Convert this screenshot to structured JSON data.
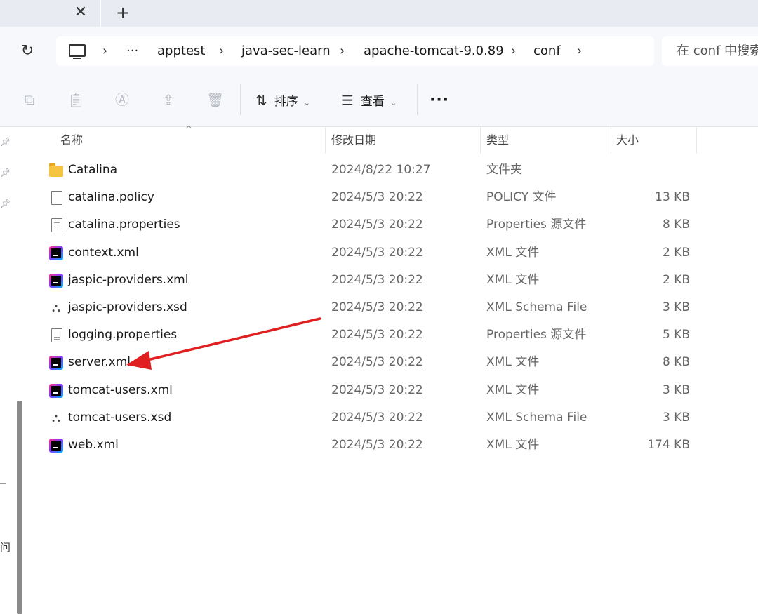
{
  "tabs": {
    "close_glyph": "✕",
    "new_glyph": "+"
  },
  "address": {
    "overflow": "···",
    "crumbs": [
      "apptest",
      "java-sec-learn",
      "apache-tomcat-9.0.89",
      "conf"
    ]
  },
  "search": {
    "placeholder": "在 conf 中搜索"
  },
  "toolbar": {
    "sort_label": "排序",
    "view_label": "查看",
    "more_label": "···"
  },
  "columns": {
    "name": "名称",
    "modified": "修改日期",
    "type": "类型",
    "size": "大小"
  },
  "files": [
    {
      "name": "Catalina",
      "modified": "2024/8/22 10:27",
      "type": "文件夹",
      "size": "",
      "icon": "folder-icon"
    },
    {
      "name": "catalina.policy",
      "modified": "2024/5/3 20:22",
      "type": "POLICY 文件",
      "size": "13 KB",
      "icon": "blank-file-icon"
    },
    {
      "name": "catalina.properties",
      "modified": "2024/5/3 20:22",
      "type": "Properties 源文件",
      "size": "8 KB",
      "icon": "text-file-icon"
    },
    {
      "name": "context.xml",
      "modified": "2024/5/3 20:22",
      "type": "XML 文件",
      "size": "2 KB",
      "icon": "jetbrains-icon"
    },
    {
      "name": "jaspic-providers.xml",
      "modified": "2024/5/3 20:22",
      "type": "XML 文件",
      "size": "2 KB",
      "icon": "jetbrains-icon"
    },
    {
      "name": "jaspic-providers.xsd",
      "modified": "2024/5/3 20:22",
      "type": "XML Schema File",
      "size": "3 KB",
      "icon": "schema-icon"
    },
    {
      "name": "logging.properties",
      "modified": "2024/5/3 20:22",
      "type": "Properties 源文件",
      "size": "5 KB",
      "icon": "text-file-icon"
    },
    {
      "name": "server.xml",
      "modified": "2024/5/3 20:22",
      "type": "XML 文件",
      "size": "8 KB",
      "icon": "jetbrains-icon"
    },
    {
      "name": "tomcat-users.xml",
      "modified": "2024/5/3 20:22",
      "type": "XML 文件",
      "size": "3 KB",
      "icon": "jetbrains-icon"
    },
    {
      "name": "tomcat-users.xsd",
      "modified": "2024/5/3 20:22",
      "type": "XML Schema File",
      "size": "3 KB",
      "icon": "schema-icon"
    },
    {
      "name": "web.xml",
      "modified": "2024/5/3 20:22",
      "type": "XML 文件",
      "size": "174 KB",
      "icon": "jetbrains-icon"
    }
  ],
  "nav": {
    "partial_char": "问"
  },
  "annotation": {
    "arrow_color": "#e02020"
  }
}
